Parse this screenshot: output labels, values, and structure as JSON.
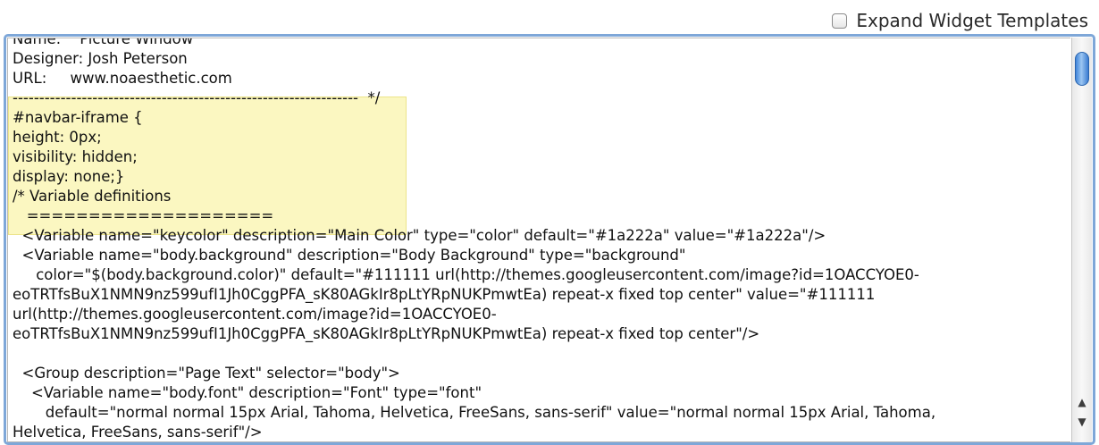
{
  "expand_widget_templates": {
    "label": "Expand Widget Templates",
    "checked": false
  },
  "editor": {
    "lines": [
      "Name:    Picture Window",
      "Designer: Josh Peterson",
      "URL:     www.noaesthetic.com",
      "-----------------------------------------------------------------  */",
      "#navbar-iframe {",
      "height: 0px;",
      "visibility: hidden;",
      "display: none;}",
      "/* Variable definitions",
      "   ====================",
      "  <Variable name=\"keycolor\" description=\"Main Color\" type=\"color\" default=\"#1a222a\" value=\"#1a222a\"/>",
      "  <Variable name=\"body.background\" description=\"Body Background\" type=\"background\"",
      "     color=\"$(body.background.color)\" default=\"#111111 url(http://themes.googleusercontent.com/image?id=1OACCYOE0-",
      "eoTRTfsBuX1NMN9nz599ufI1Jh0CggPFA_sK80AGkIr8pLtYRpNUKPmwtEa) repeat-x fixed top center\" value=\"#111111",
      "url(http://themes.googleusercontent.com/image?id=1OACCYOE0-",
      "eoTRTfsBuX1NMN9nz599ufI1Jh0CggPFA_sK80AGkIr8pLtYRpNUKPmwtEa) repeat-x fixed top center\"/>",
      "",
      "  <Group description=\"Page Text\" selector=\"body\">",
      "    <Variable name=\"body.font\" description=\"Font\" type=\"font\"",
      "       default=\"normal normal 15px Arial, Tahoma, Helvetica, FreeSans, sans-serif\" value=\"normal normal 15px Arial, Tahoma,",
      "Helvetica, FreeSans, sans-serif\"/>"
    ]
  },
  "scrollbar": {
    "up_arrow": "▲",
    "down_arrow": "▼"
  },
  "colors": {
    "highlight": "#fbf7c1",
    "editor_border": "#7ea7d8",
    "scroll_thumb": "#3f84d9"
  }
}
